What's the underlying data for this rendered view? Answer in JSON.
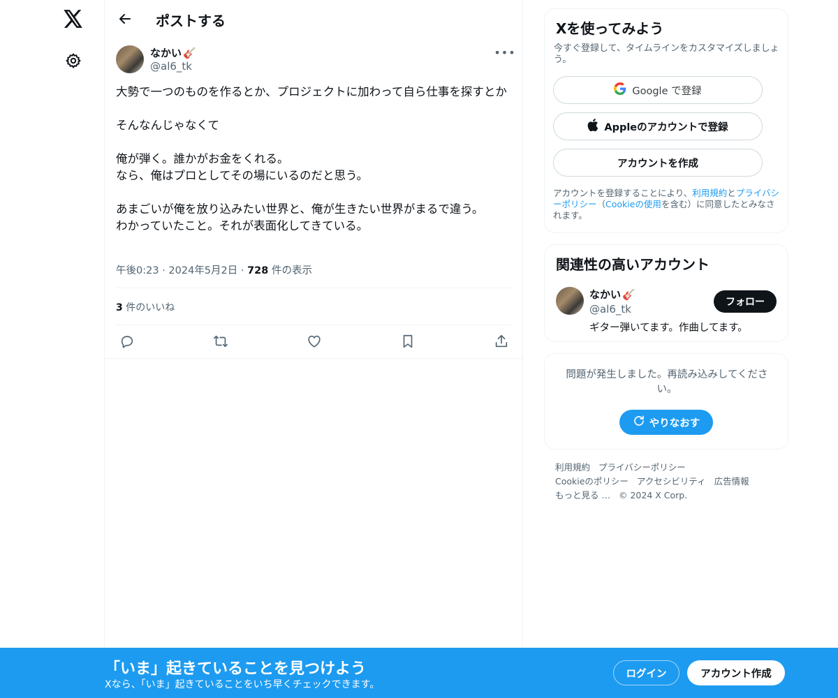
{
  "nav": {
    "logo_icon": "x-logo-icon",
    "settings_icon": "gear-icon"
  },
  "header": {
    "title": "ポストする"
  },
  "post": {
    "author_name": "なかい",
    "author_emoji": "🎸",
    "author_handle": "@al6_tk",
    "lines": [
      "大勢で一つのものを作るとか、プロジェクトに加わって自ら仕事を探すとか",
      "",
      "そんなんじゃなくて",
      "",
      "俺が弾く。誰かがお金をくれる。",
      "なら、俺はプロとしてその場にいるのだと思う。",
      "",
      "あまごいが俺を放り込みたい世界と、俺が生きたい世界がまるで違う。",
      "わかっていたこと。それが表面化してきている。"
    ],
    "time": "午後0:23",
    "date": "2024年5月2日",
    "views_count": "728",
    "views_label": "件の表示",
    "likes_count": "3",
    "likes_label": "件のいいね"
  },
  "signup_card": {
    "title": "Xを使ってみよう",
    "subtitle": "今すぐ登録して、タイムラインをカスタマイズしましょう。",
    "google_label": "Google で登録",
    "apple_label": "Appleのアカウントで登録",
    "create_label": "アカウントを作成",
    "legal_prefix": "アカウントを登録することにより、",
    "legal_terms": "利用規約",
    "legal_and": "と",
    "legal_privacy": "プライバシーポリシー",
    "legal_paren_open": "（",
    "legal_cookie": "Cookieの使用",
    "legal_suffix": "を含む）に同意したとみなされます。"
  },
  "related": {
    "title": "関連性の高いアカウント",
    "name": "なかい",
    "emoji": "🎸",
    "handle": "@al6_tk",
    "bio": "ギター弾いてます。作曲してます。",
    "follow_label": "フォロー"
  },
  "error_card": {
    "message": "問題が発生しました。再読み込みしてください。",
    "retry_label": "やりなおす"
  },
  "footer": {
    "links": [
      "利用規約",
      "プライバシーポリシー",
      "Cookieのポリシー",
      "アクセシビリティ",
      "広告情報",
      "もっと見る …",
      "© 2024 X Corp."
    ]
  },
  "banner": {
    "title": "「いま」起きていることを見つけよう",
    "subtitle": "Xなら、「いま」起きていることをいち早くチェックできます。",
    "login_label": "ログイン",
    "signup_label": "アカウント作成"
  },
  "colors": {
    "accent": "#1d9bf0",
    "text_primary": "#0f1419",
    "text_secondary": "#536471",
    "border": "#eff3f4"
  }
}
